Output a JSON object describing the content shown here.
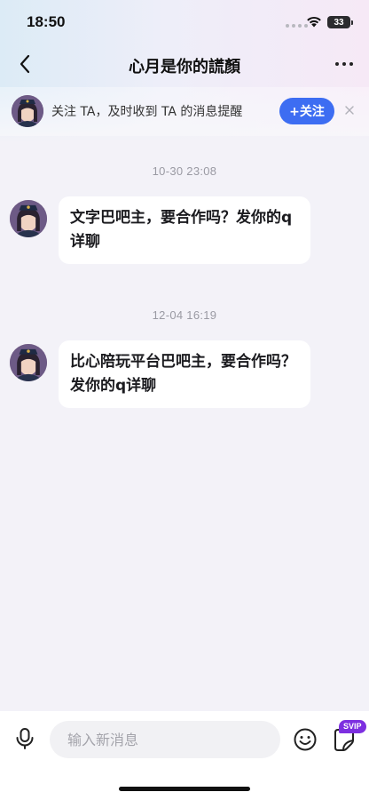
{
  "status_bar": {
    "time": "18:50",
    "battery": "33"
  },
  "nav": {
    "title": "心月是你的謊顏"
  },
  "follow_banner": {
    "text": "关注 TA，及时收到 TA 的消息提醒",
    "button_label": "+关注"
  },
  "messages": [
    {
      "timestamp": "10-30  23:08",
      "text": "文字巴吧主，要合作吗？发你的q详聊"
    },
    {
      "timestamp": "12-04  16:19",
      "text": "比心陪玩平台巴吧主，要合作吗？发你的q详聊"
    }
  ],
  "input_bar": {
    "placeholder": "输入新消息",
    "svip_badge": "SVIP"
  },
  "colors": {
    "accent": "#3d6df2",
    "svip": "#7d2fe0",
    "background": "#f3f2f8"
  }
}
